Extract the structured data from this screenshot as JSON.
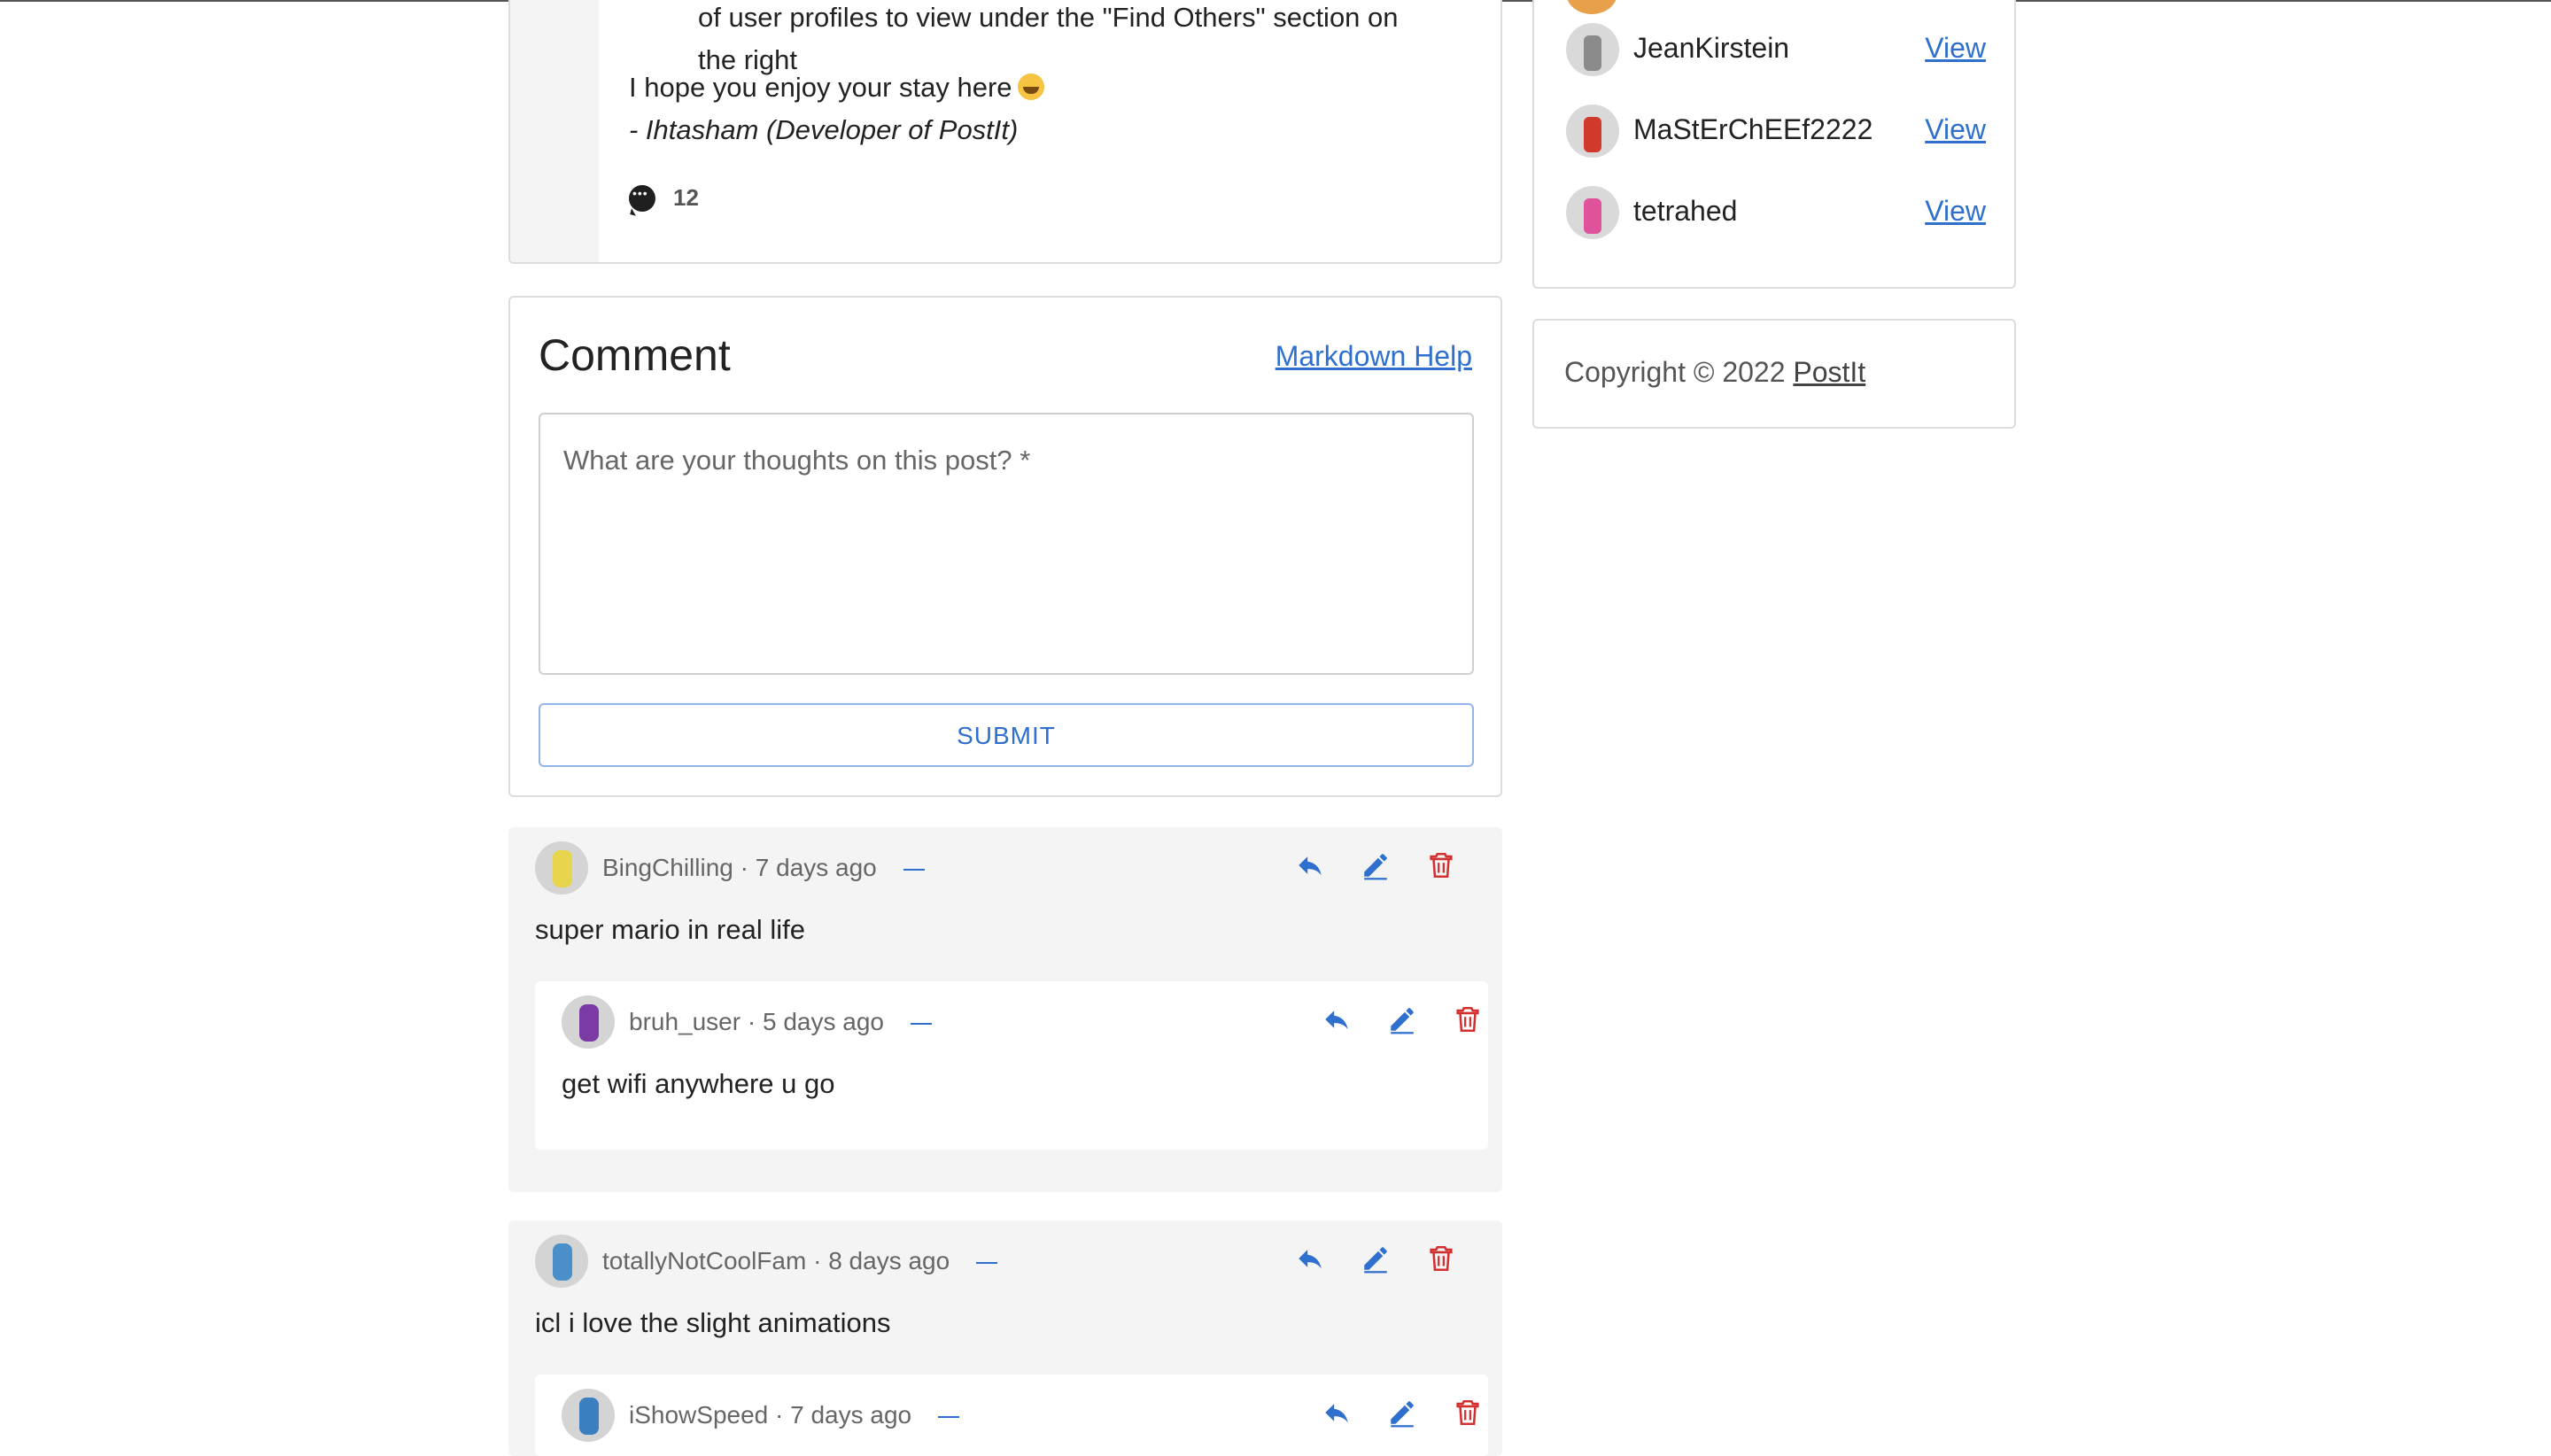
{
  "post": {
    "list_continuation_line1": "of user profiles to view under the \"Find Others\" section on",
    "list_continuation_line2": "the right",
    "outro": "I hope you enjoy your stay here",
    "signature": "- Ihtasham (Developer of PostIt)",
    "comment_count": "12"
  },
  "sidebar": {
    "users": [
      {
        "name": "JeanKirstein",
        "view_label": "View"
      },
      {
        "name": "MaStErChEEf2222",
        "view_label": "View"
      },
      {
        "name": "tetrahed",
        "view_label": "View"
      }
    ],
    "copyright_prefix": "Copyright © 2022",
    "copyright_link": "PostIt"
  },
  "composer": {
    "title": "Comment",
    "markdown_help": "Markdown Help",
    "placeholder": "What are your thoughts on this post? *",
    "submit_label": "SUBMIT"
  },
  "comments": [
    {
      "author": "BingChilling",
      "time": "7 days ago",
      "body": "super mario in real life",
      "replies": [
        {
          "author": "bruh_user",
          "time": "5 days ago",
          "body": "get wifi anywhere u go"
        }
      ]
    },
    {
      "author": "totallyNotCoolFam",
      "time": "8 days ago",
      "body": "icl i love the slight animations",
      "replies": [
        {
          "author": "iShowSpeed",
          "time": "7 days ago",
          "body": ""
        }
      ]
    }
  ],
  "meta_separator": " · ",
  "colors": {
    "link": "#2f6fce",
    "delete": "#d32f2f",
    "thread_bg": "#f4f4f4"
  }
}
